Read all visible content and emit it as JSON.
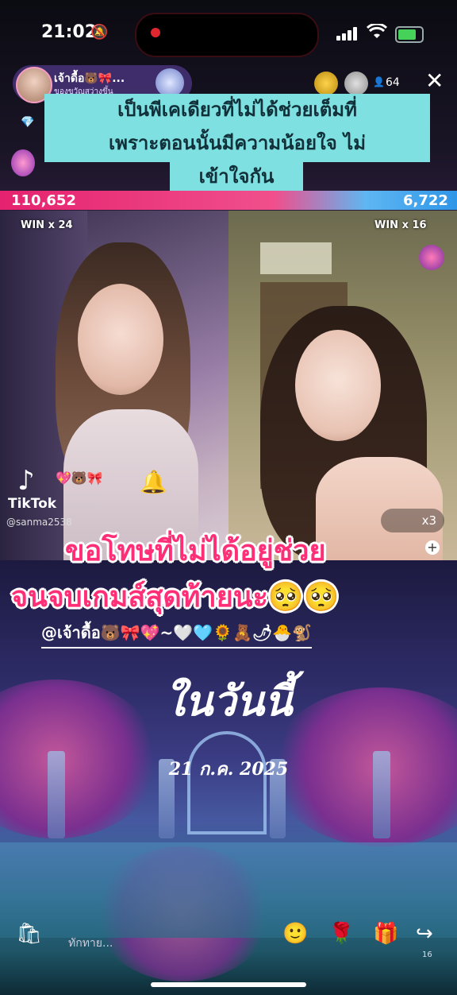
{
  "status_bar": {
    "time": "21:02"
  },
  "live_header": {
    "host_name": "เจ้าดื้อ🐻🎀...",
    "host_subtitle": "ของขวัญสว่างขึ้น",
    "viewer_count": "64",
    "close_label": "✕"
  },
  "caption_overlay": {
    "line1": "เป็นพีเคเดียวที่ไม่ได้ช่วยเต็มที่",
    "line2": "เพราะตอนนั้นมีความน้อยใจ ไม่",
    "line3": "เข้าใจกัน"
  },
  "battle": {
    "score_left": "110,652",
    "score_right": "6,722",
    "win_left": "WIN x 24",
    "win_right": "WIN x 16",
    "gift_multiplier": "x3"
  },
  "tiktok": {
    "logo_text": "TikTok",
    "username": "@sanma2538"
  },
  "captions": {
    "line1": "ขอโทษที่ไม่ได้อยู่ช่วย",
    "line2": "จนจบเกมส์สุดท้ายนะ🥺🥺",
    "mention": "@เจ้าดื้อ🐻🎀💖~🤍🩵🌻🧸🌶🐣🐒",
    "today": "ในวันนี้",
    "date": "21 ก.ค. 2025"
  },
  "bottom_bar": {
    "comment_placeholder": "ทักทาย...",
    "share_count": "16",
    "icons": [
      "emoji-icon",
      "rose-gift-icon",
      "gift-icon",
      "share-icon"
    ]
  },
  "colors": {
    "score_left": "#e5226f",
    "score_right": "#2f96e8",
    "caption_bg": "#7ee0e0",
    "pink_text": "#ff2f77"
  }
}
